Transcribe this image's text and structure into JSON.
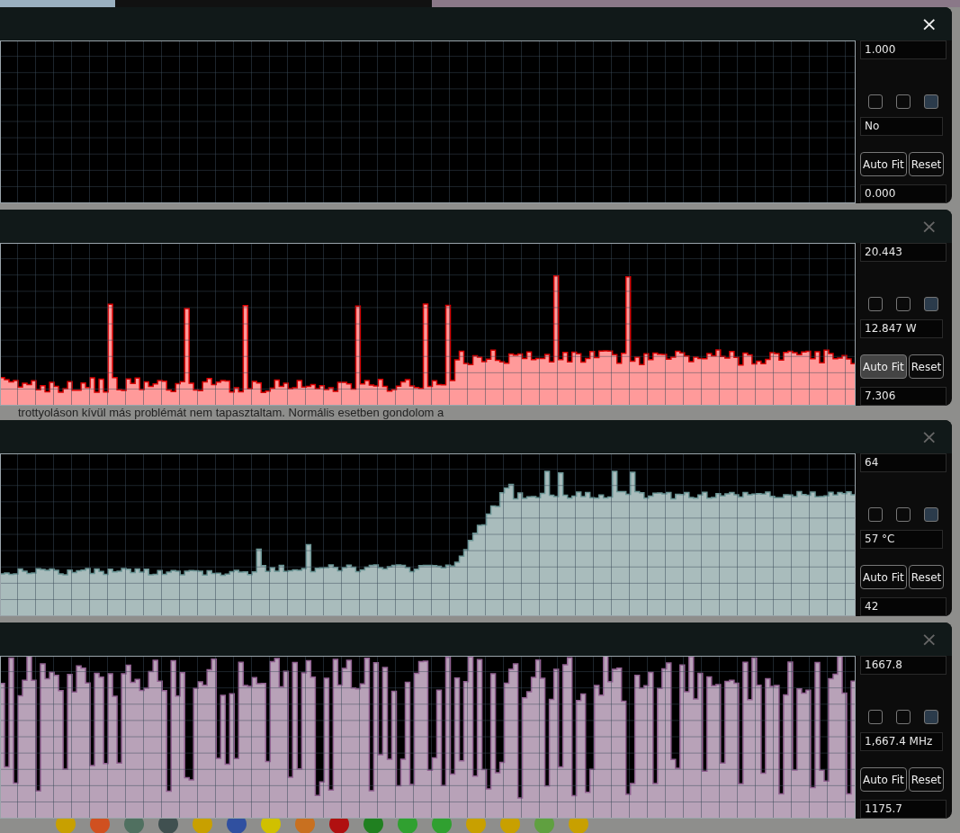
{
  "background_text": "trottyoláson kívül más problémát nem tapasztaltam. Normális esetben gondolom a",
  "windows": [
    {
      "close_active": true,
      "max": "1.000",
      "current": "No",
      "min": "0.000",
      "auto_fit_selected": false,
      "checkboxes": [
        {
          "checked": false
        },
        {
          "checked": false
        },
        {
          "checked": true
        }
      ],
      "close": "×",
      "auto_fit": "Auto Fit",
      "reset": "Reset"
    },
    {
      "close_active": false,
      "max": "20.443",
      "current": "12.847 W",
      "min": "7.306",
      "auto_fit_selected": true,
      "checkboxes": [
        {
          "checked": false
        },
        {
          "checked": false
        },
        {
          "checked": true
        }
      ],
      "close": "×",
      "auto_fit": "Auto Fit",
      "reset": "Reset",
      "graph": {
        "color": "#ff9a9a"
      }
    },
    {
      "close_active": false,
      "max": "64",
      "current": "57 °C",
      "min": "42",
      "auto_fit_selected": false,
      "checkboxes": [
        {
          "checked": false
        },
        {
          "checked": false
        },
        {
          "checked": true
        }
      ],
      "close": "×",
      "auto_fit": "Auto Fit",
      "reset": "Reset",
      "graph": {
        "color": "#a9bcbc"
      }
    },
    {
      "close_active": false,
      "max": "1667.8",
      "current": "1,667.4 MHz",
      "min": "1175.7",
      "auto_fit_selected": false,
      "checkboxes": [
        {
          "checked": false
        },
        {
          "checked": false
        },
        {
          "checked": true
        }
      ],
      "close": "×",
      "auto_fit": "Auto Fit",
      "reset": "Reset",
      "graph": {
        "color": "#b8a2b8"
      }
    }
  ]
}
